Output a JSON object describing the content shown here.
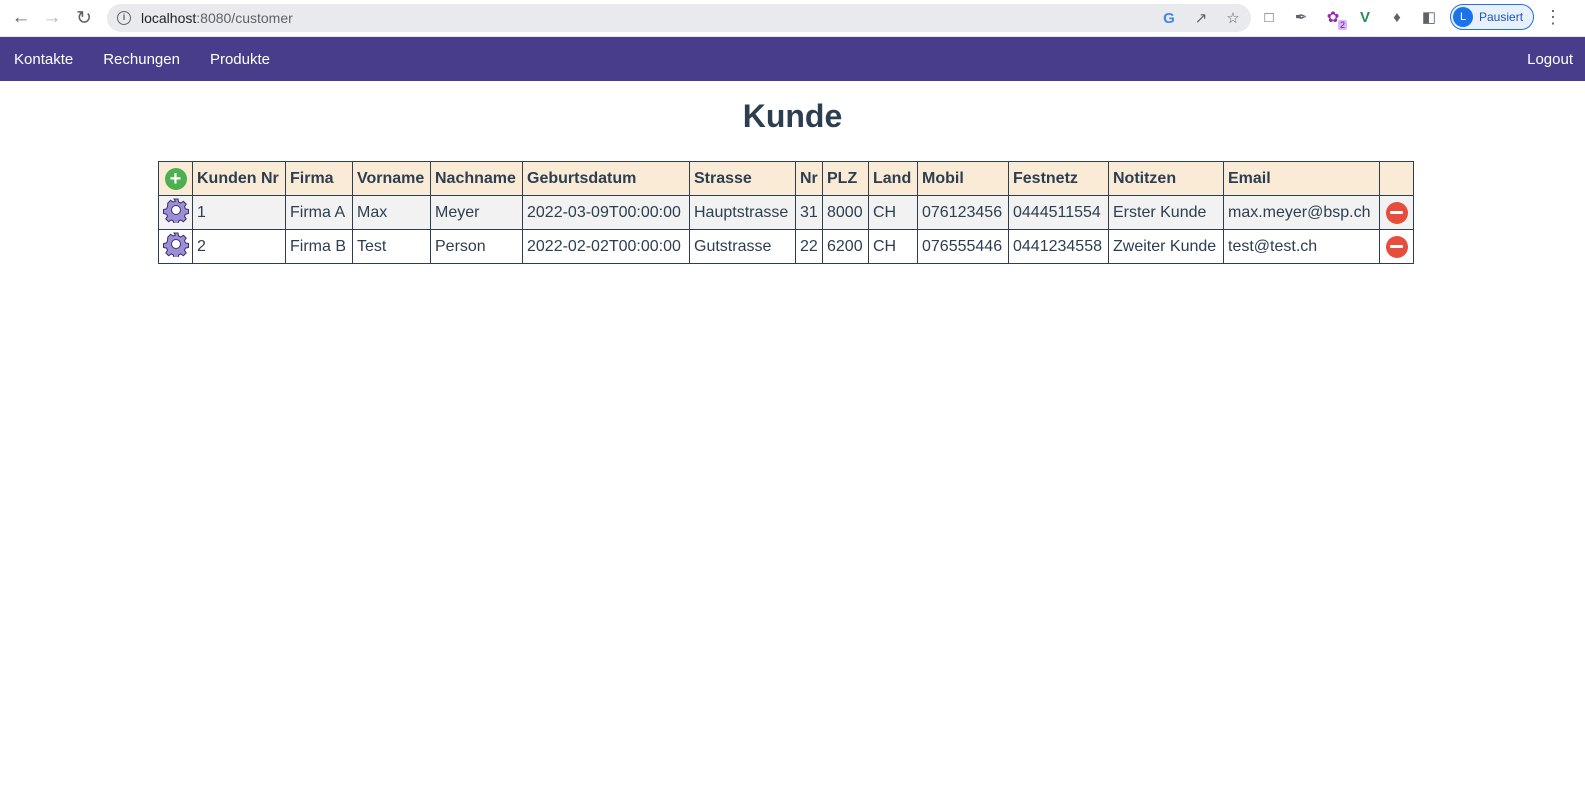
{
  "browser": {
    "url_host": "localhost",
    "url_path": ":8080/customer",
    "profile_initial": "L",
    "profile_status": "Pausiert",
    "ext_badge": "2"
  },
  "navbar": {
    "links": [
      "Kontakte",
      "Rechungen",
      "Produkte"
    ],
    "logout": "Logout"
  },
  "page": {
    "title": "Kunde"
  },
  "table": {
    "headers": [
      "Kunden Nr",
      "Firma",
      "Vorname",
      "Nachname",
      "Geburtsdatum",
      "Strasse",
      "Nr",
      "PLZ",
      "Land",
      "Mobil",
      "Festnetz",
      "Notitzen",
      "Email"
    ],
    "rows": [
      [
        "1",
        "Firma A",
        "Max",
        "Meyer",
        "2022-03-09T00:00:00",
        "Hauptstrasse",
        "31",
        "8000",
        "CH",
        "076123456",
        "0444511554",
        "Erster Kunde",
        "max.meyer@bsp.ch"
      ],
      [
        "2",
        "Firma B",
        "Test",
        "Person",
        "2022-02-02T00:00:00",
        "Gutstrasse",
        "22",
        "6200",
        "CH",
        "076555446",
        "0441234558",
        "Zweiter Kunde",
        "test@test.ch"
      ]
    ]
  },
  "colors": {
    "navbar_bg": "#483d8b",
    "header_bg": "#faebd7",
    "add_icon": "#4caf50",
    "delete_icon": "#e74c3c",
    "gear_icon": "#9c8fd6"
  }
}
